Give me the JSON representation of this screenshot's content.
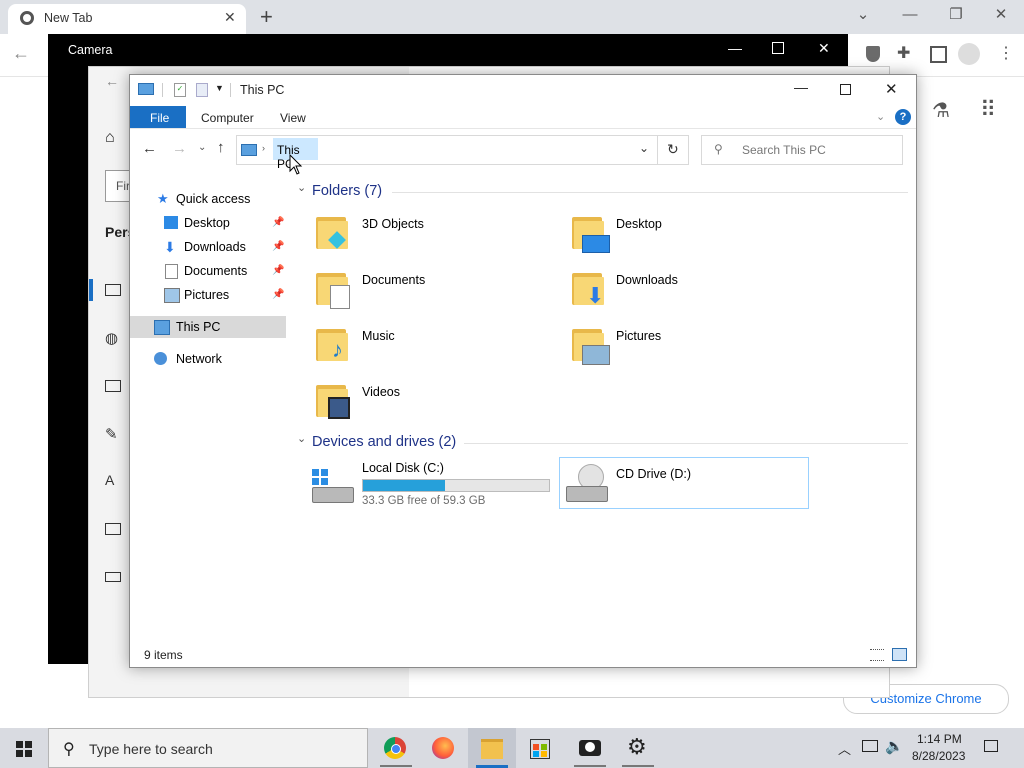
{
  "chrome": {
    "tab_title": "New Tab",
    "new_tab_symbol": "+",
    "customize_label": "Customize Chrome",
    "controls": {
      "minimize": "—",
      "maximize": "❐",
      "close": "✕",
      "search_tabs": "⌄"
    }
  },
  "camera": {
    "title": "Camera"
  },
  "settings": {
    "search_stub": "Fir",
    "section_stub": "Pers"
  },
  "explorer": {
    "title": "This PC",
    "ribbon": {
      "file": "File",
      "computer": "Computer",
      "view": "View"
    },
    "address": "This PC",
    "search_placeholder": "Search This PC",
    "nav": {
      "quick_access": "Quick access",
      "desktop": "Desktop",
      "downloads": "Downloads",
      "documents": "Documents",
      "pictures": "Pictures",
      "this_pc": "This PC",
      "network": "Network"
    },
    "folders_header": "Folders (7)",
    "folders": {
      "objects3d": "3D Objects",
      "desktop": "Desktop",
      "documents": "Documents",
      "downloads": "Downloads",
      "music": "Music",
      "pictures": "Pictures",
      "videos": "Videos"
    },
    "devices_header": "Devices and drives (2)",
    "drives": {
      "c_name": "Local Disk (C:)",
      "c_free": "33.3 GB free of 59.3 GB",
      "c_used_fraction": 0.44,
      "d_name": "CD Drive (D:)"
    },
    "status": "9 items"
  },
  "taskbar": {
    "search_placeholder": "Type here to search",
    "time": "1:14 PM",
    "date": "8/28/2023"
  },
  "colors": {
    "accent": "#1a6fc4",
    "disk_bar": "#26a0da",
    "header_blue": "#1e3287",
    "selection": "#cce8ff"
  }
}
